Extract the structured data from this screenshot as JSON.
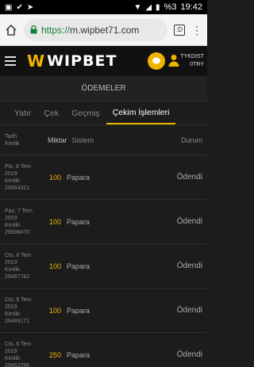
{
  "statusbar": {
    "battery": "%3",
    "time": "19:42"
  },
  "browser": {
    "url_scheme": "https://",
    "url_host": "m.wipbet71.com",
    "tab_count": ":D"
  },
  "header": {
    "logo_text": "WIPBET",
    "user_line1": "TYKDIST",
    "user_line2": "0TRY"
  },
  "section_title": "ÖDEMELER",
  "tabs": [
    {
      "label": "Yatır"
    },
    {
      "label": "Çek"
    },
    {
      "label": "Geçmiş"
    },
    {
      "label": "Çekim İşlemleri"
    }
  ],
  "table": {
    "head_date": "Tarih",
    "head_id": "Kimlik",
    "head_amount": "Miktar",
    "head_system": "Sistem",
    "head_status": "Durum",
    "rows": [
      {
        "date1": "Pts, 8 Tem",
        "date2": "2019",
        "id_label": "Kimlik:",
        "id": "29564321",
        "amount": "100",
        "system": "Papara",
        "status": "Ödendi"
      },
      {
        "date1": "Paz, 7 Tem",
        "date2": "2019",
        "id_label": "Kimlik:",
        "id": "29508470",
        "amount": "100",
        "system": "Papara",
        "status": "Ödendi"
      },
      {
        "date1": "Cts, 6 Tem",
        "date2": "2019",
        "id_label": "Kimlik:",
        "id": "29497782",
        "amount": "100",
        "system": "Papara",
        "status": "Ödendi"
      },
      {
        "date1": "Cts, 6 Tem",
        "date2": "2019",
        "id_label": "Kimlik:",
        "id": "29489171",
        "amount": "100",
        "system": "Papara",
        "status": "Ödendi"
      },
      {
        "date1": "Cts, 6 Tem",
        "date2": "2019",
        "id_label": "Kimlik:",
        "id": "29452296",
        "amount": "250",
        "system": "Papara",
        "status": "Ödendi"
      }
    ]
  },
  "colors": {
    "accent": "#f0b400",
    "background": "#1c1c1c"
  }
}
